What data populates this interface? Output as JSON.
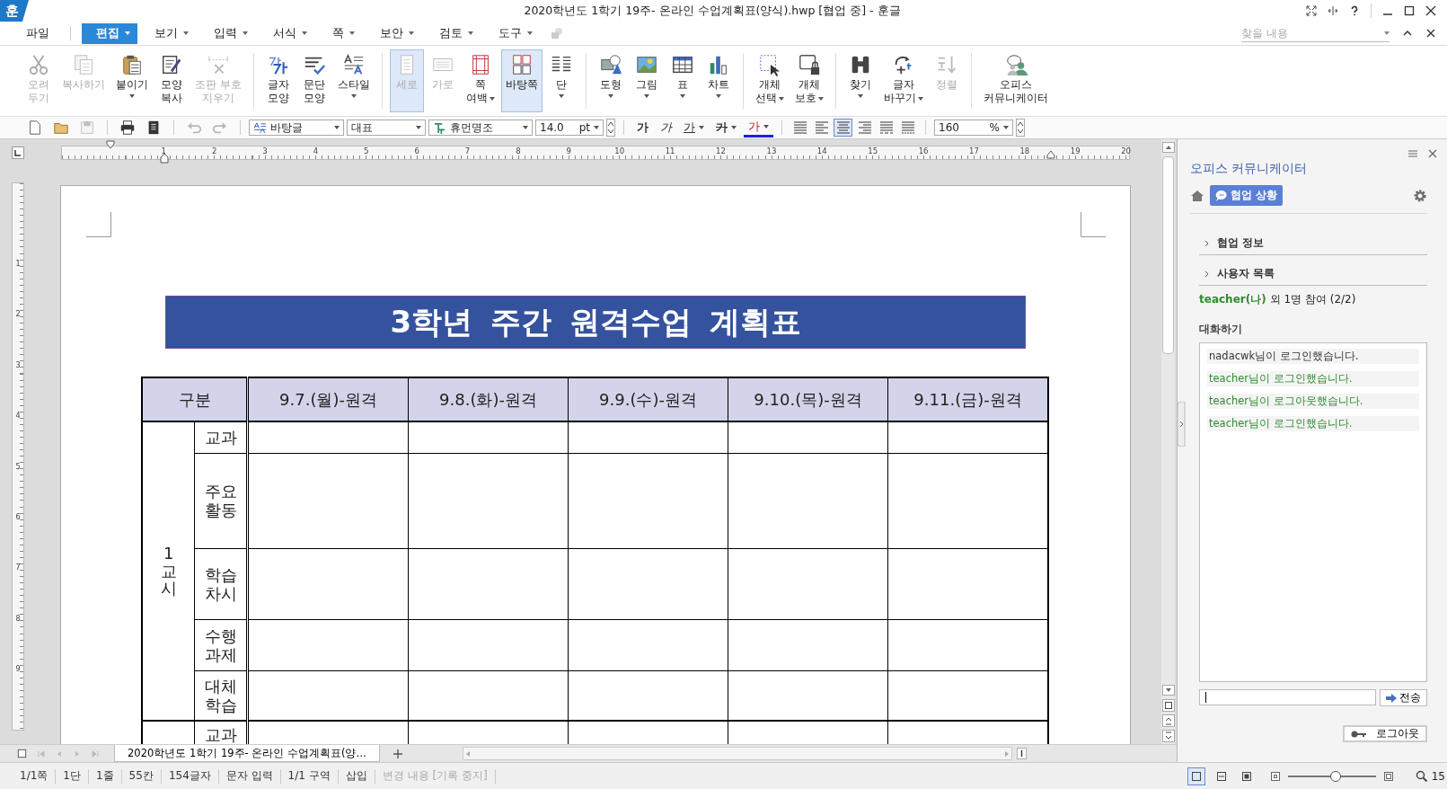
{
  "window": {
    "app_badge": "훈",
    "title": "2020학년도 1학기 19주- 온라인 수업계획표(양식).hwp [협업 중] - 훈글"
  },
  "menu": [
    {
      "label": "파일",
      "selected": false,
      "dropdown": false
    },
    {
      "label": "편집",
      "selected": true,
      "dropdown": true
    },
    {
      "label": "보기",
      "selected": false,
      "dropdown": true
    },
    {
      "label": "입력",
      "selected": false,
      "dropdown": true
    },
    {
      "label": "서식",
      "selected": false,
      "dropdown": true
    },
    {
      "label": "쪽",
      "selected": false,
      "dropdown": true
    },
    {
      "label": "보안",
      "selected": false,
      "dropdown": true
    },
    {
      "label": "검토",
      "selected": false,
      "dropdown": true
    },
    {
      "label": "도구",
      "selected": false,
      "dropdown": true
    }
  ],
  "find_box": {
    "placeholder": "찾을 내용"
  },
  "ribbon": {
    "groups": [
      {
        "items": [
          {
            "lines": [
              "오려",
              "두기"
            ],
            "disabled": true,
            "selected": false,
            "dropdown": false
          },
          {
            "lines": [
              "복사하기"
            ],
            "disabled": true,
            "selected": false,
            "dropdown": false
          },
          {
            "lines": [
              "붙이기"
            ],
            "disabled": false,
            "selected": false,
            "dropdown": true
          },
          {
            "lines": [
              "모양",
              "복사"
            ],
            "disabled": false,
            "selected": false,
            "dropdown": false
          },
          {
            "lines": [
              "조판 부호",
              "지우기"
            ],
            "disabled": true,
            "selected": false,
            "dropdown": false
          }
        ]
      },
      {
        "items": [
          {
            "lines": [
              "글자",
              "모양"
            ],
            "disabled": false,
            "selected": false,
            "dropdown": false
          },
          {
            "lines": [
              "문단",
              "모양"
            ],
            "disabled": false,
            "selected": false,
            "dropdown": false
          },
          {
            "lines": [
              "스타일"
            ],
            "disabled": false,
            "selected": false,
            "dropdown": true
          }
        ]
      },
      {
        "items": [
          {
            "lines": [
              "세로"
            ],
            "disabled": true,
            "selected": true,
            "dropdown": false
          },
          {
            "lines": [
              "가로"
            ],
            "disabled": true,
            "selected": false,
            "dropdown": false
          },
          {
            "lines": [
              "쪽",
              "여백"
            ],
            "disabled": false,
            "selected": false,
            "dropdown": true
          },
          {
            "lines": [
              "바탕쪽"
            ],
            "disabled": false,
            "selected": true,
            "dropdown": false
          },
          {
            "lines": [
              "단"
            ],
            "disabled": false,
            "selected": false,
            "dropdown": true
          }
        ]
      },
      {
        "items": [
          {
            "lines": [
              "도형"
            ],
            "disabled": false,
            "selected": false,
            "dropdown": true
          },
          {
            "lines": [
              "그림"
            ],
            "disabled": false,
            "selected": false,
            "dropdown": true
          },
          {
            "lines": [
              "표"
            ],
            "disabled": false,
            "selected": false,
            "dropdown": true
          },
          {
            "lines": [
              "차트"
            ],
            "disabled": false,
            "selected": false,
            "dropdown": true
          }
        ]
      },
      {
        "items": [
          {
            "lines": [
              "개체",
              "선택"
            ],
            "disabled": false,
            "selected": false,
            "dropdown": true
          },
          {
            "lines": [
              "개체",
              "보호"
            ],
            "disabled": false,
            "selected": false,
            "dropdown": true
          }
        ]
      },
      {
        "items": [
          {
            "lines": [
              "찾기"
            ],
            "disabled": false,
            "selected": false,
            "dropdown": true
          },
          {
            "lines": [
              "글자",
              "바꾸기"
            ],
            "disabled": false,
            "selected": false,
            "dropdown": true
          },
          {
            "lines": [
              "정렬"
            ],
            "disabled": true,
            "selected": false,
            "dropdown": false
          }
        ]
      },
      {
        "items": [
          {
            "lines": [
              "오피스",
              "커뮤니케이터"
            ],
            "disabled": false,
            "selected": false,
            "dropdown": false
          }
        ]
      }
    ]
  },
  "format_bar": {
    "file_buttons": [
      {
        "disabled": false
      },
      {
        "disabled": false
      },
      {
        "disabled": true
      },
      {
        "disabled": false
      },
      {
        "disabled": false
      },
      {
        "disabled": true
      },
      {
        "disabled": true
      }
    ],
    "style_box": "바탕글",
    "language_box": "대표",
    "font_box": "휴먼명조",
    "size_box": "14.0",
    "size_unit": "pt",
    "char_buttons": [
      {
        "label": "가",
        "kind": "bold",
        "dropdown": false
      },
      {
        "label": "가",
        "kind": "italic",
        "dropdown": false
      },
      {
        "label": "가",
        "kind": "underline",
        "dropdown": true
      },
      {
        "label": "가",
        "kind": "strike",
        "dropdown": true
      },
      {
        "label": "가",
        "kind": "color",
        "dropdown": true
      }
    ],
    "align_buttons": [
      {
        "selected": false
      },
      {
        "selected": false
      },
      {
        "selected": true
      },
      {
        "selected": false
      },
      {
        "selected": false
      },
      {
        "selected": false
      }
    ],
    "zoom_box": "160",
    "zoom_unit": "%"
  },
  "ruler": {
    "labels": [
      "1",
      "2",
      "3",
      "4",
      "5",
      "6",
      "7",
      "8",
      "9",
      "10",
      "11",
      "12",
      "13",
      "14",
      "15",
      "16",
      "17",
      "18",
      "19",
      "20"
    ]
  },
  "vertical_ruler": {
    "labels": [
      "1",
      "2",
      "3",
      "4",
      "5",
      "6",
      "7",
      "8",
      "9"
    ]
  },
  "document": {
    "banner": "3학년 주간 원격수업 계획표",
    "columns": [
      "구분",
      "9.7.(월)-원격",
      "9.8.(화)-원격",
      "9.9.(수)-원격",
      "9.10.(목)-원격",
      "9.11.(금)-원격"
    ],
    "periods": [
      {
        "label": "1교시",
        "rows": [
          {
            "lines": [
              "교과"
            ]
          },
          {
            "lines": [
              "주요",
              "활동"
            ]
          },
          {
            "lines": [
              "학습",
              "차시"
            ]
          },
          {
            "lines": [
              "수행",
              "과제"
            ]
          },
          {
            "lines": [
              "대체",
              "학습"
            ]
          }
        ]
      },
      {
        "rows": [
          {
            "lines": [
              "교과"
            ]
          }
        ]
      }
    ]
  },
  "document_tabs": [
    {
      "label": "2020학년도 1학기 19주- 온라인 수업계획표(양…",
      "selected": true
    }
  ],
  "communicator": {
    "title": "오피스 커뮤니케이터",
    "status_button": "협업 상황",
    "sections": [
      {
        "label": "협업 정보",
        "expanded": false
      },
      {
        "label": "사용자 목록",
        "expanded": false
      }
    ],
    "participants": {
      "user": "teacher(나)",
      "summary": "외 1명 참여 (2/2)"
    },
    "chat_label": "대화하기",
    "messages": [
      {
        "text": "nadacwk님이 로그인했습니다.",
        "color": "#333333"
      },
      {
        "text": "teacher님이 로그인했습니다.",
        "color": "#2e8b2e"
      },
      {
        "text": "teacher님이 로그아웃했습니다.",
        "color": "#2e8b2e"
      },
      {
        "text": "teacher님이 로그인했습니다.",
        "color": "#2e8b2e"
      }
    ],
    "chat_input": {
      "focused": true
    },
    "send_button": "전송",
    "logout_button": "로그아웃"
  },
  "status_bar": {
    "items": [
      {
        "label": "1/1쪽",
        "disabled": false
      },
      {
        "label": "1단",
        "disabled": false
      },
      {
        "label": "1줄",
        "disabled": false
      },
      {
        "label": "55칸",
        "disabled": false
      },
      {
        "label": "154글자",
        "disabled": false
      },
      {
        "label": "문자 입력",
        "disabled": false
      },
      {
        "label": "1/1 구역",
        "disabled": false
      },
      {
        "label": "삽입",
        "disabled": false
      },
      {
        "label": "변경 내용 [기록 중지]",
        "disabled": true
      }
    ],
    "view_buttons": [
      {
        "selected": true
      },
      {
        "selected": false
      },
      {
        "selected": false
      }
    ],
    "zoom_slider": {
      "level": 0.54
    },
    "zoom_text": "15"
  }
}
